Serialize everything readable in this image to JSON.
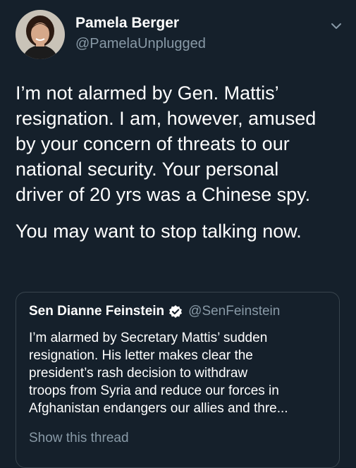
{
  "colors": {
    "background": "#15202b",
    "primary_text": "#ffffff",
    "secondary_text": "#8899a6",
    "border": "#38444d",
    "verified_badge": "#ffffff"
  },
  "tweet": {
    "author_name": "Pamela Berger",
    "author_handle": "@PamelaUnplugged",
    "avatar_icon": "profile-photo",
    "menu_icon": "chevron-down-icon",
    "body_paragraph_1": "I’m not alarmed by Gen. Mattis’\nresignation.  I am, however, amused\nby your concern of threats to our\nnational security. Your personal\ndriver of 20 yrs was a Chinese spy.",
    "body_paragraph_2": "You may want to stop talking now."
  },
  "quoted_tweet": {
    "author_name": "Sen Dianne Feinstein",
    "verified_icon": "verified-badge-icon",
    "author_handle": "@SenFeinstein",
    "text": "I’m alarmed by Secretary Mattis’ sudden\nresignation. His letter makes clear the\npresident’s rash decision to withdraw\ntroops from Syria and reduce our forces in\nAfghanistan endangers our allies and thre...",
    "show_thread_label": "Show this thread"
  }
}
